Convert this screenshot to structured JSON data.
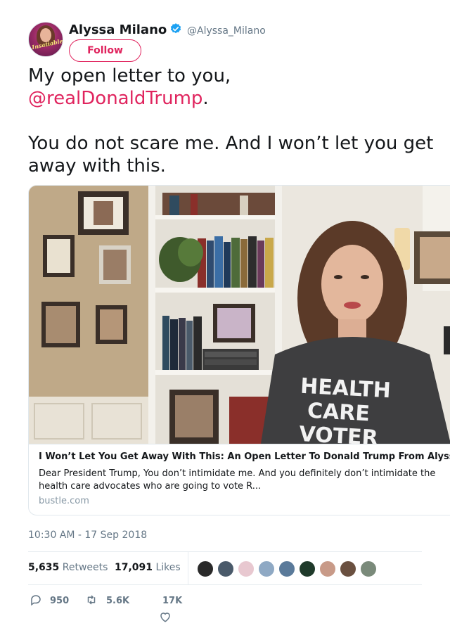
{
  "profile": {
    "name": "Alyssa Milano",
    "handle": "@Alyssa_Milano",
    "avatar_tag": "Insatiable",
    "follow_label": "Follow",
    "verified_color": "#1da1f2"
  },
  "tweet": {
    "line1": "My open letter to you,",
    "mention": "@realDonaldTrump",
    "mention_suffix": ".",
    "line3": "You do not scare me. And I won’t let you get away with this."
  },
  "card": {
    "title": "I Won’t Let You Get Away With This: An Open Letter To Donald Trump From Alyssa Milano",
    "description": "Dear President Trump, You don’t intimidate me. And you definitely don’t intimidate the health care advocates who are going to vote R...",
    "description_display": "Dear President Trump, You don’t intimidate me. And you definitely don’t intimidate t health care advocates who are going to vote R...",
    "domain": "bustle.com",
    "shirt_text": [
      "HEALTH",
      "CARE",
      "VOTER"
    ]
  },
  "timestamp": "10:30 AM - 17 Sep 2018",
  "stats": {
    "retweets_count": "5,635",
    "retweets_label": "Retweets",
    "likes_count": "17,091",
    "likes_label": "Likes"
  },
  "actions": {
    "replies": "950",
    "retweets": "5.6K",
    "likes": "17K"
  },
  "colors": {
    "accent": "#e0245e",
    "muted": "#657786",
    "border": "#e1e8ed"
  }
}
